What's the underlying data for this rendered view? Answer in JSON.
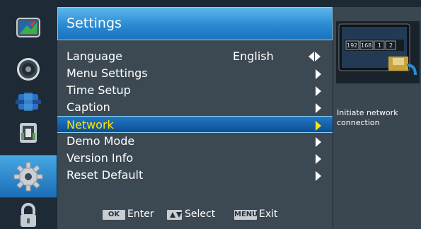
{
  "sidebar": {
    "items": [
      {
        "name": "picture-icon"
      },
      {
        "name": "audio-icon"
      },
      {
        "name": "channel-icon"
      },
      {
        "name": "parental-lock-icon"
      },
      {
        "name": "settings-gear-icon",
        "active": true
      },
      {
        "name": "lock-icon"
      }
    ]
  },
  "header": {
    "title": "Settings"
  },
  "menu": {
    "items": [
      {
        "label": "Language",
        "value": "English",
        "control": "left-right"
      },
      {
        "label": "Menu Settings",
        "control": "arrow"
      },
      {
        "label": "Time Setup",
        "control": "arrow"
      },
      {
        "label": "Caption",
        "control": "arrow"
      },
      {
        "label": "Network",
        "control": "arrow",
        "selected": true
      },
      {
        "label": "Demo Mode",
        "control": "arrow"
      },
      {
        "label": "Version Info",
        "control": "arrow"
      },
      {
        "label": "Reset Default",
        "control": "arrow"
      }
    ]
  },
  "hints": {
    "ok_key": "OK",
    "enter": "Enter",
    "select": "Select",
    "menu_key": "MENU",
    "exit": "Exit"
  },
  "info_panel": {
    "ip_fields": [
      "192",
      "168",
      "1",
      "2"
    ],
    "description": "Initiate network connection"
  },
  "colors": {
    "accent": "#2a8ad2",
    "selected_text": "#ffe600",
    "panel": "#3c4953"
  }
}
